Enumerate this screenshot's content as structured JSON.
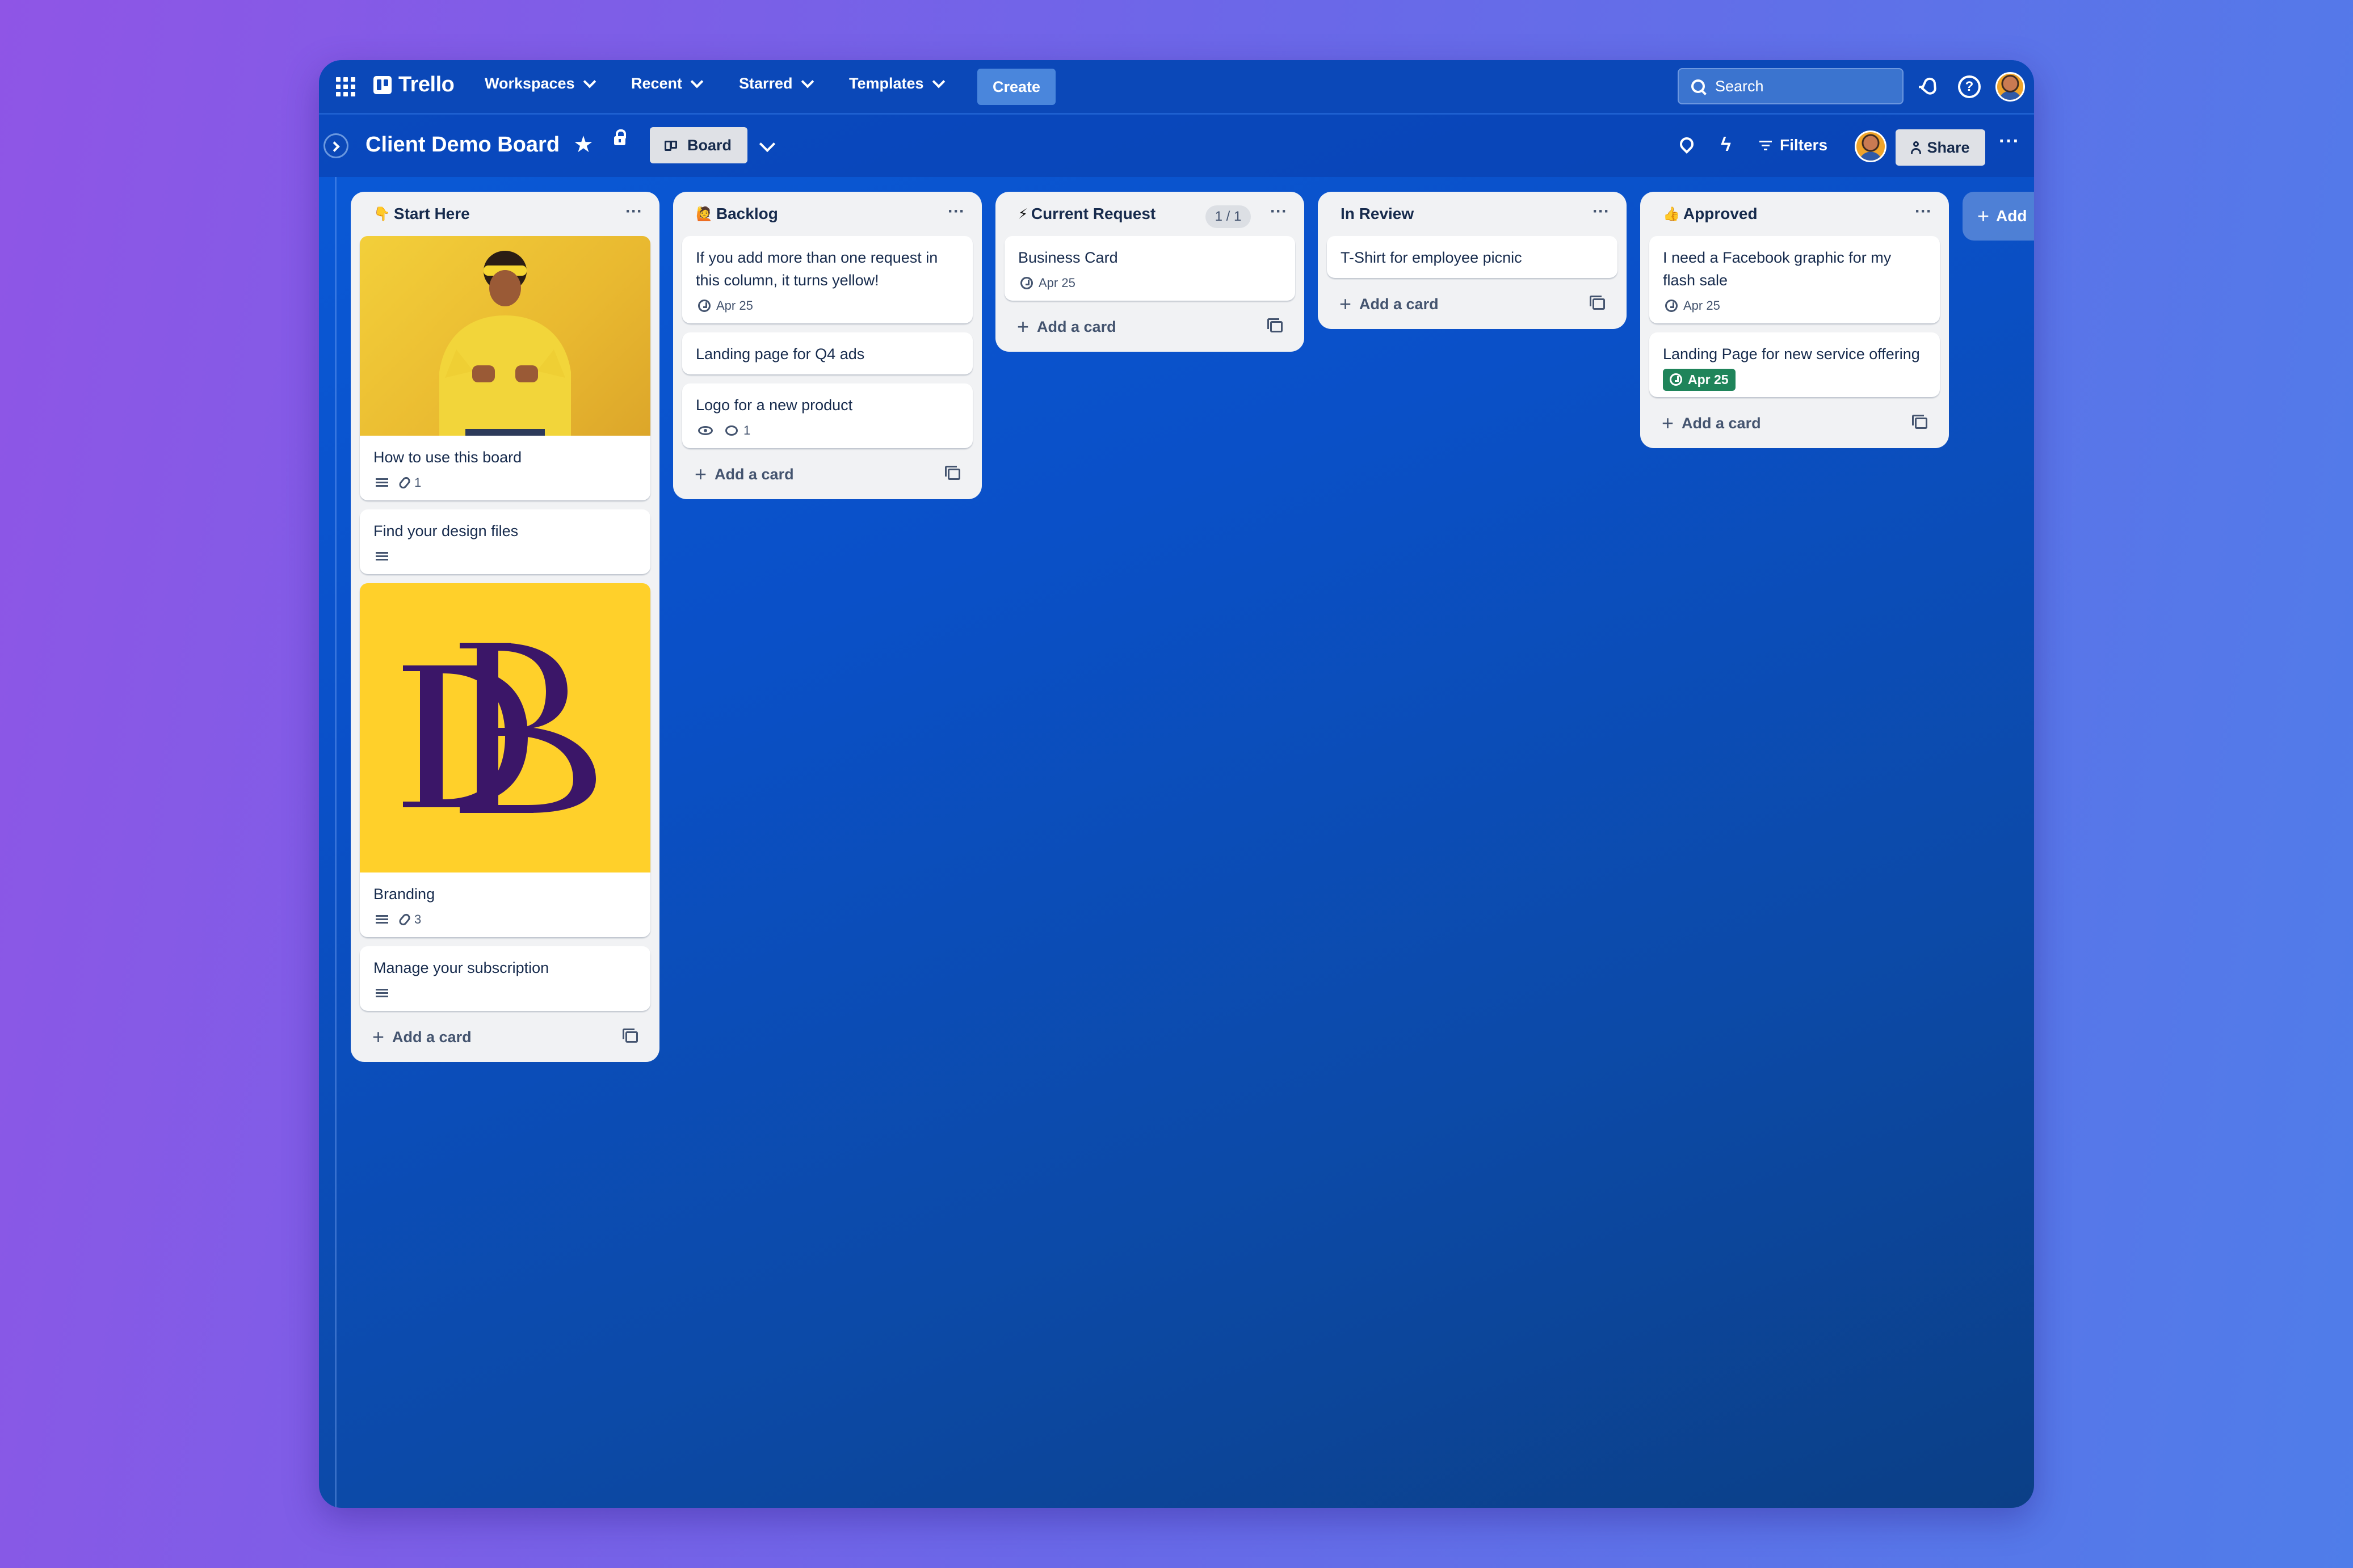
{
  "topnav": {
    "logo": "Trello",
    "items": [
      {
        "label": "Workspaces"
      },
      {
        "label": "Recent"
      },
      {
        "label": "Starred"
      },
      {
        "label": "Templates"
      }
    ],
    "create_label": "Create",
    "search_placeholder": "Search"
  },
  "board": {
    "title": "Client Demo Board",
    "view_label": "Board",
    "filters_label": "Filters",
    "share_label": "Share",
    "add_list_label": "Add"
  },
  "lists": [
    {
      "title": "Start Here",
      "emoji": "👇",
      "cards": [
        {
          "title": "How to use this board",
          "attachments": "1"
        },
        {
          "title": "Find your design files"
        },
        {
          "title": "Branding",
          "attachments": "3"
        },
        {
          "title": "Manage your subscription"
        }
      ],
      "add_label": "Add a card"
    },
    {
      "title": "Backlog",
      "emoji": "🙋",
      "cards": [
        {
          "title": "If you add more than one request in this column, it turns yellow!",
          "due": "Apr 25"
        },
        {
          "title": "Landing page for Q4 ads"
        },
        {
          "title": "Logo for a new product",
          "comments": "1"
        }
      ],
      "add_label": "Add a card"
    },
    {
      "title": "Current Request",
      "emoji": "⚡",
      "count": "1 / 1",
      "cards": [
        {
          "title": "Business Card",
          "due": "Apr 25"
        }
      ],
      "add_label": "Add a card"
    },
    {
      "title": "In Review",
      "cards": [
        {
          "title": "T-Shirt for employee picnic"
        }
      ],
      "add_label": "Add a card"
    },
    {
      "title": "Approved",
      "emoji": "👍",
      "cards": [
        {
          "title": "I need a Facebook graphic for my flash sale",
          "due": "Apr 25"
        },
        {
          "title": "Landing Page for new service offering",
          "due": "Apr 25"
        }
      ],
      "add_label": "Add a card"
    }
  ],
  "colors": {
    "nav_bg": "#0b48b8",
    "list_bg": "#f1f2f4",
    "due_complete": "#1f845a",
    "branding_yellow": "#ffd02a",
    "branding_purple": "#3b1668"
  },
  "icons": [
    "apps-grid-icon",
    "trello-logo-icon",
    "search-icon",
    "bell-icon",
    "help-icon",
    "star-icon",
    "lock-icon",
    "board-icon",
    "rocket-icon",
    "bolt-icon",
    "filter-icon",
    "person-add-icon",
    "more-icon",
    "description-icon",
    "attachment-icon",
    "clock-icon",
    "eye-icon",
    "comment-icon",
    "plus-icon",
    "template-icon"
  ]
}
